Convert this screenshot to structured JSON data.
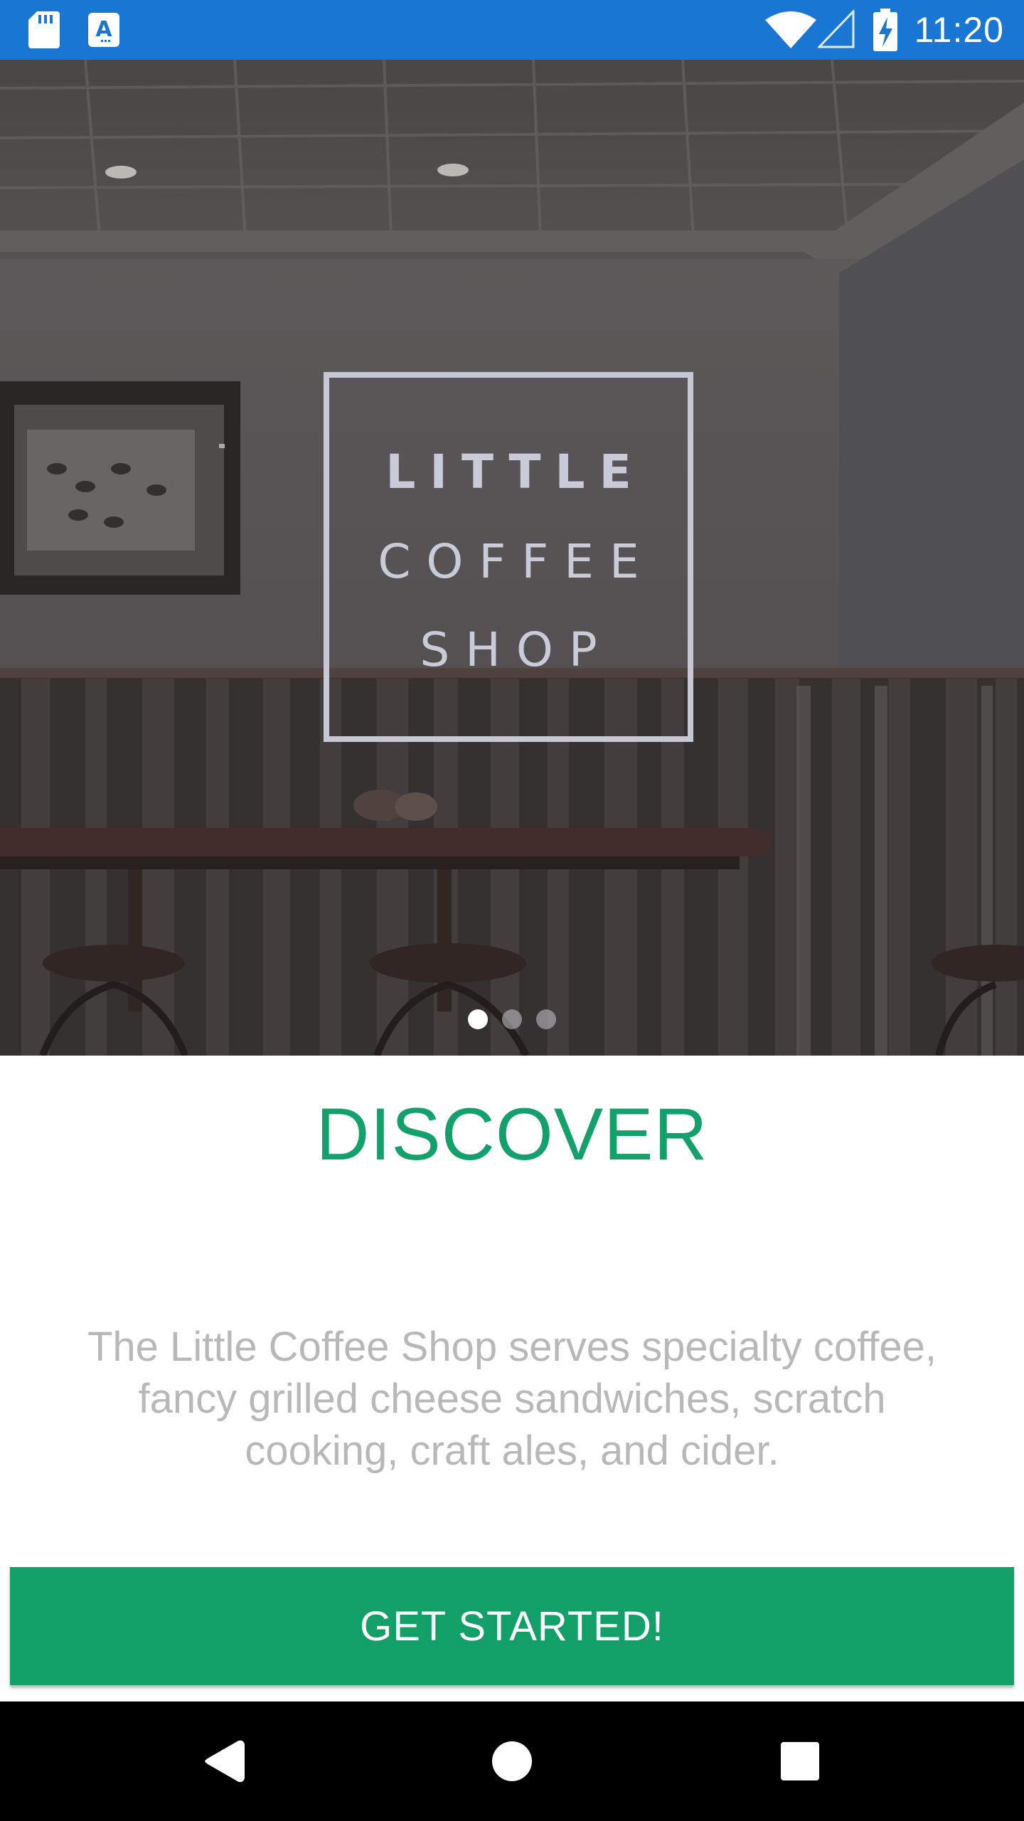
{
  "status_bar": {
    "time": "11:20",
    "background_color": "#1976d2",
    "left_icons": [
      "sd-card-icon",
      "accessibility-a-icon"
    ],
    "right_icons": [
      "wifi-icon",
      "cellular-signal-icon",
      "battery-charging-icon"
    ]
  },
  "hero": {
    "logo": {
      "line1": "LITTLE",
      "line2": "COFFEE",
      "line3": "SHOP"
    },
    "pager": {
      "total": 3,
      "active_index": 0
    }
  },
  "content": {
    "headline": "DISCOVER",
    "headline_color": "#14a06a",
    "description": "The Little Coffee Shop serves specialty coffee, fancy grilled cheese sandwiches, scratch cooking, craft ales, and cider."
  },
  "cta": {
    "label": "GET STARTED!",
    "color": "#139f68"
  },
  "nav_bar": {
    "buttons": [
      "back-icon",
      "home-icon",
      "recents-icon"
    ]
  }
}
